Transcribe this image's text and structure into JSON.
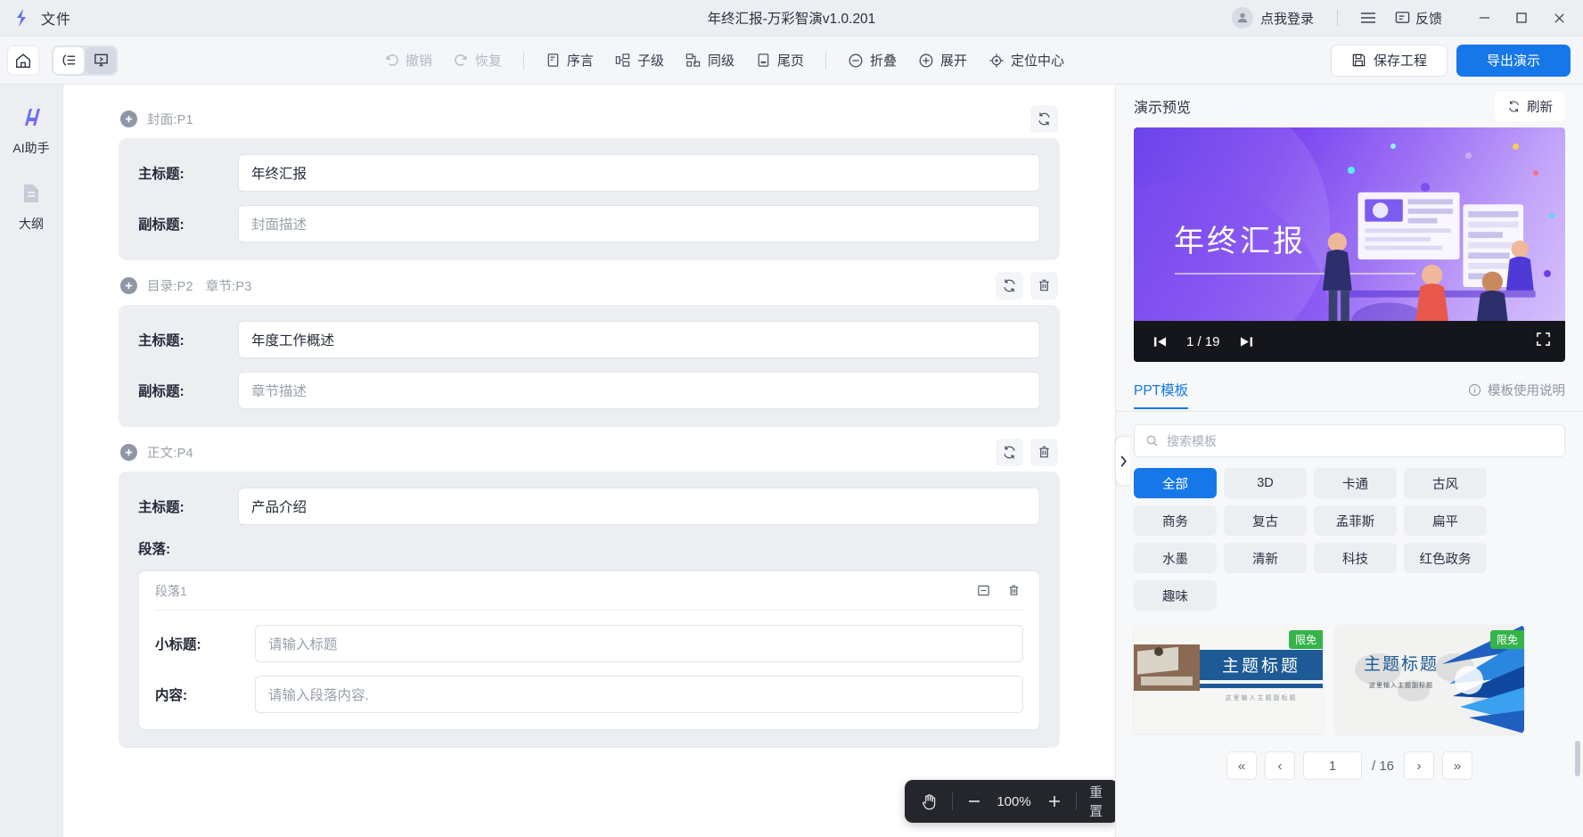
{
  "titlebar": {
    "file_menu": "文件",
    "window_title": "年终汇报-万彩智演v1.0.201",
    "login_label": "点我登录",
    "feedback_label": "反馈",
    "menu_icon": "hamburger-menu-icon",
    "minimize_icon": "minimize-icon",
    "maximize_icon": "maximize-icon",
    "close_icon": "close-icon"
  },
  "toolbar": {
    "home_icon": "home-icon",
    "outline_mode_icon": "outline-list-icon",
    "slide_mode_icon": "presentation-screen-icon",
    "undo": "撤销",
    "redo": "恢复",
    "preface": "序言",
    "child_level": "子级",
    "same_level": "同级",
    "tail_page": "尾页",
    "collapse": "折叠",
    "expand": "展开",
    "locate_center": "定位中心",
    "save_project": "保存工程",
    "export_presentation": "导出演示"
  },
  "rail": {
    "items": [
      {
        "label": "AI助手",
        "icon": "ai-assistant-icon"
      },
      {
        "label": "大纲",
        "icon": "outline-document-icon"
      }
    ]
  },
  "editor": {
    "sections": [
      {
        "title": "封面:P1",
        "title_parts": [
          "封面:P1"
        ],
        "has_refresh": true,
        "has_delete": false,
        "fields": [
          {
            "label": "主标题:",
            "value": "年终汇报",
            "is_placeholder": false
          },
          {
            "label": "副标题:",
            "value": "封面描述",
            "is_placeholder": true
          }
        ]
      },
      {
        "title": "目录:P2  章节:P3",
        "title_parts": [
          "目录:P2",
          "章节:P3"
        ],
        "has_refresh": true,
        "has_delete": true,
        "fields": [
          {
            "label": "主标题:",
            "value": "年度工作概述",
            "is_placeholder": false
          },
          {
            "label": "副标题:",
            "value": "章节描述",
            "is_placeholder": true
          }
        ]
      },
      {
        "title": "正文:P4",
        "title_parts": [
          "正文:P4"
        ],
        "has_refresh": true,
        "has_delete": true,
        "fields": [
          {
            "label": "主标题:",
            "value": "产品介绍",
            "is_placeholder": false
          }
        ],
        "paragraph_block_label": "段落:",
        "paragraph": {
          "name": "段落1",
          "collapse_icon": "collapse-minus-icon",
          "delete_icon": "trash-icon",
          "fields": [
            {
              "label": "小标题:",
              "value": "请输入标题"
            },
            {
              "label": "内容:",
              "value": "请输入段落内容."
            }
          ]
        }
      }
    ],
    "collapse_handle_icon": "chevron-right-icon"
  },
  "right_panel": {
    "title": "演示预览",
    "refresh_label": "刷新",
    "refresh_icon": "refresh-icon",
    "preview": {
      "slide_title": "年终汇报",
      "prev_icon": "skip-previous-icon",
      "next_icon": "skip-next-icon",
      "page_indicator": "1 / 19",
      "fullscreen_icon": "fullscreen-icon"
    },
    "tab_label": "PPT模板",
    "help_label": "模板使用说明",
    "help_icon": "info-circle-icon",
    "search_placeholder": "搜索模板",
    "search_value": "",
    "search_icon": "search-icon",
    "categories": [
      {
        "label": "全部",
        "active": true
      },
      {
        "label": "3D",
        "active": false
      },
      {
        "label": "卡通",
        "active": false
      },
      {
        "label": "古风",
        "active": false
      },
      {
        "label": "商务",
        "active": false
      },
      {
        "label": "复古",
        "active": false
      },
      {
        "label": "孟菲斯",
        "active": false
      },
      {
        "label": "扁平",
        "active": false
      },
      {
        "label": "水墨",
        "active": false
      },
      {
        "label": "清新",
        "active": false
      },
      {
        "label": "科技",
        "active": false
      },
      {
        "label": "红色政务",
        "active": false
      },
      {
        "label": "趣味",
        "active": false
      }
    ],
    "templates": [
      {
        "badge": "限免",
        "title": "主题标题",
        "subtitle": "这里输入主题副标题",
        "style": "photo-blue"
      },
      {
        "badge": "限免",
        "title": "主题标题",
        "subtitle": "这里输入主题副标题",
        "style": "world-map-blue"
      }
    ],
    "pager": {
      "first": "«",
      "prev": "‹",
      "current": "1",
      "total": "/ 16",
      "next": "›",
      "last": "»"
    }
  },
  "zoom_overlay": {
    "hand_icon": "hand-pan-icon",
    "minus": "−",
    "value": "100%",
    "plus": "+",
    "reset": "重置"
  },
  "colors": {
    "accent_blue": "#1677e8",
    "badge_green": "#34b44a",
    "panel_gray": "#eceef2",
    "slide_purple": "#5b2ee8"
  }
}
